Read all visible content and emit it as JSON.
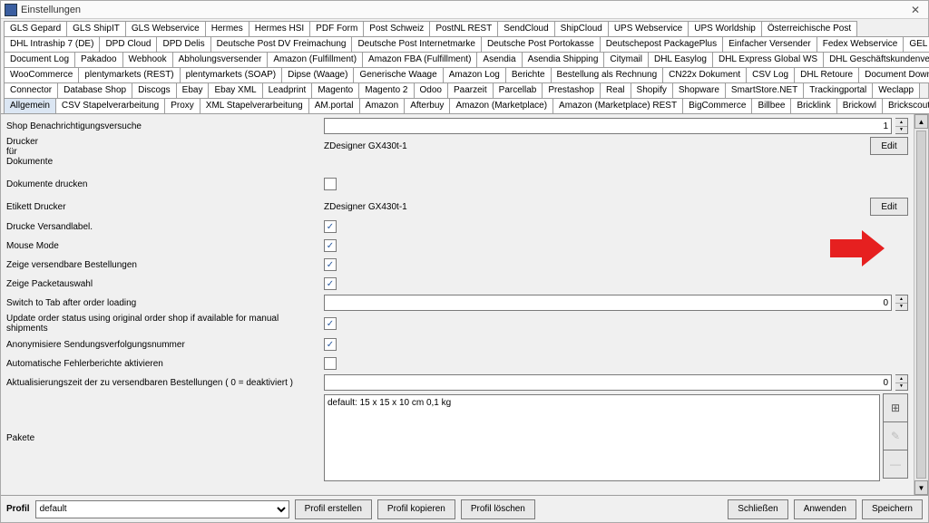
{
  "window": {
    "title": "Einstellungen"
  },
  "tab_rows": [
    [
      "GLS Gepard",
      "GLS ShipIT",
      "GLS Webservice",
      "Hermes",
      "Hermes HSI",
      "PDF Form",
      "Post Schweiz",
      "PostNL REST",
      "SendCloud",
      "ShipCloud",
      "UPS Webservice",
      "UPS Worldship",
      "Österreichische Post"
    ],
    [
      "DHL Intraship 7 (DE)",
      "DPD Cloud",
      "DPD Delis",
      "Deutsche Post DV Freimachung",
      "Deutsche Post Internetmarke",
      "Deutsche Post Portokasse",
      "Deutschepost PackagePlus",
      "Einfacher Versender",
      "Fedex Webservice",
      "GEL Express"
    ],
    [
      "Document Log",
      "Pakadoo",
      "Webhook",
      "Abholungsversender",
      "Amazon (Fulfillment)",
      "Amazon FBA (Fulfillment)",
      "Asendia",
      "Asendia Shipping",
      "Citymail",
      "DHL Easylog",
      "DHL Express Global WS",
      "DHL Geschäftskundenversand"
    ],
    [
      "WooCommerce",
      "plentymarkets (REST)",
      "plentymarkets (SOAP)",
      "Dipse (Waage)",
      "Generische Waage",
      "Amazon Log",
      "Berichte",
      "Bestellung als Rechnung",
      "CN22x Dokument",
      "CSV Log",
      "DHL Retoure",
      "Document Downloader"
    ],
    [
      "Connector",
      "Database Shop",
      "Discogs",
      "Ebay",
      "Ebay XML",
      "Leadprint",
      "Magento",
      "Magento 2",
      "Odoo",
      "Paarzeit",
      "Parcellab",
      "Prestashop",
      "Real",
      "Shopify",
      "Shopware",
      "SmartStore.NET",
      "Trackingportal",
      "Weclapp"
    ],
    [
      "Allgemein",
      "CSV Stapelverarbeitung",
      "Proxy",
      "XML Stapelverarbeitung",
      "AM.portal",
      "Amazon",
      "Afterbuy",
      "Amazon (Marketplace)",
      "Amazon (Marketplace) REST",
      "BigCommerce",
      "Billbee",
      "Bricklink",
      "Brickowl",
      "Brickscout"
    ]
  ],
  "selected_tab": "Allgemein",
  "fields": {
    "notify_label": "Shop Benachrichtigungsversuche",
    "notify_value": "1",
    "doc_printer_label": "Drucker\nfür\nDokumente",
    "doc_printer_value": "ZDesigner GX430t-1",
    "edit_label": "Edit",
    "print_docs_label": "Dokumente drucken",
    "print_docs_checked": false,
    "label_printer_label": "Etikett Drucker",
    "label_printer_value": "ZDesigner GX430t-1",
    "print_shipping_label": "Drucke Versandlabel.",
    "print_shipping_checked": true,
    "mouse_mode_label": "Mouse Mode",
    "mouse_mode_checked": true,
    "show_shippable_label": "Zeige versendbare Bestellungen",
    "show_shippable_checked": true,
    "show_packet_label": "Zeige Packetauswahl",
    "show_packet_checked": true,
    "switch_tab_label": "Switch to Tab after order loading",
    "switch_tab_value": "0",
    "update_status_label": "Update order status using original order shop if available for manual shipments",
    "update_status_checked": true,
    "anon_track_label": "Anonymisiere Sendungsverfolgungsnummer",
    "anon_track_checked": true,
    "auto_error_label": "Automatische Fehlerberichte aktivieren",
    "auto_error_checked": false,
    "refresh_time_label": "Aktualisierungszeit der zu versendbaren Bestellungen ( 0 = deaktiviert )",
    "refresh_time_value": "0",
    "packages_label": "Pakete",
    "packages_content": "default: 15 x 15 x 10 cm 0,1 kg"
  },
  "footer": {
    "profile_label": "Profil",
    "profile_value": "default",
    "create": "Profil erstellen",
    "copy": "Profil kopieren",
    "delete": "Profil löschen",
    "close": "Schließen",
    "apply": "Anwenden",
    "save": "Speichern"
  }
}
